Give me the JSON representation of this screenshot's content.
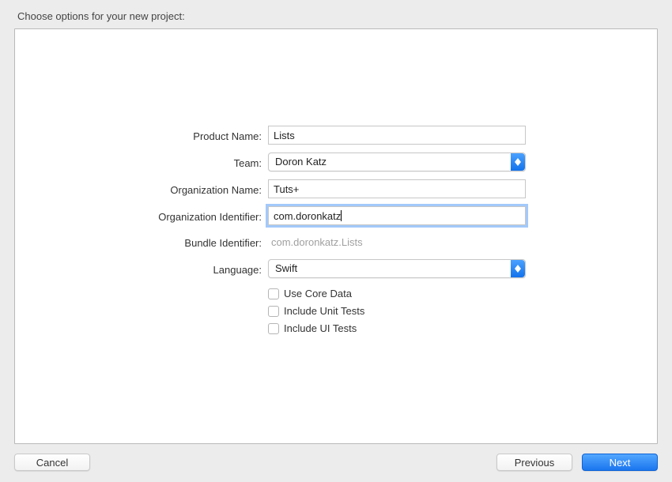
{
  "title": "Choose options for your new project:",
  "form": {
    "product_name": {
      "label": "Product Name:",
      "value": "Lists"
    },
    "team": {
      "label": "Team:",
      "value": "Doron Katz"
    },
    "organization_name": {
      "label": "Organization Name:",
      "value": "Tuts+"
    },
    "organization_identifier": {
      "label": "Organization Identifier:",
      "value": "com.doronkatz"
    },
    "bundle_identifier": {
      "label": "Bundle Identifier:",
      "value": "com.doronkatz.Lists"
    },
    "language": {
      "label": "Language:",
      "value": "Swift"
    },
    "use_core_data": {
      "label": "Use Core Data",
      "checked": false
    },
    "include_unit_tests": {
      "label": "Include Unit Tests",
      "checked": false
    },
    "include_ui_tests": {
      "label": "Include UI Tests",
      "checked": false
    }
  },
  "buttons": {
    "cancel": "Cancel",
    "previous": "Previous",
    "next": "Next"
  }
}
